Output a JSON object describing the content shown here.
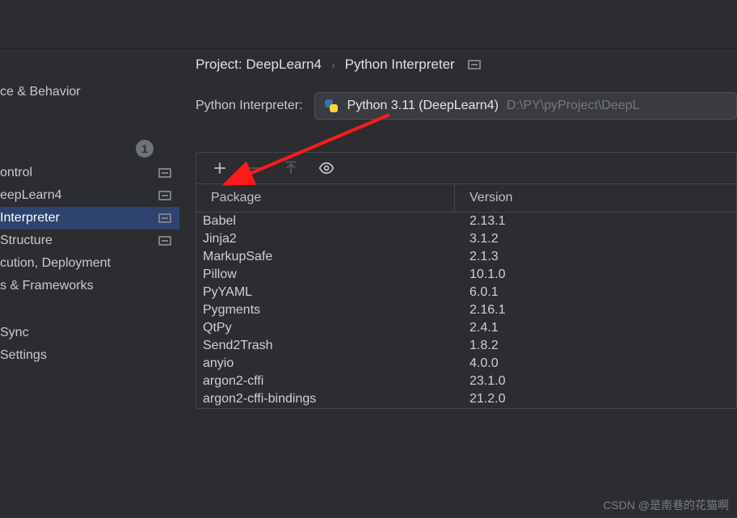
{
  "sidebar": {
    "items": [
      {
        "label": "ce & Behavior",
        "badge": null,
        "modif": false
      },
      {
        "label": "",
        "badge": "1",
        "modif": false
      },
      {
        "label": "ontrol",
        "badge": null,
        "modif": true
      },
      {
        "label": "eepLearn4",
        "badge": null,
        "modif": true
      },
      {
        "label": "Interpreter",
        "badge": null,
        "modif": true
      },
      {
        "label": "Structure",
        "badge": null,
        "modif": true
      },
      {
        "label": "cution, Deployment",
        "badge": null,
        "modif": false
      },
      {
        "label": "s & Frameworks",
        "badge": null,
        "modif": false
      },
      {
        "label": "Sync",
        "badge": null,
        "modif": false
      },
      {
        "label": "Settings",
        "badge": null,
        "modif": false
      }
    ],
    "selected_index": 4
  },
  "breadcrumb": {
    "project_prefix": "Project:",
    "project_name": "DeepLearn4",
    "page": "Python Interpreter"
  },
  "interpreter": {
    "label": "Python Interpreter:",
    "name": "Python 3.11 (DeepLearn4)",
    "path": "D:\\PY\\pyProject\\DeepL"
  },
  "packages": {
    "header_package": "Package",
    "header_version": "Version",
    "rows": [
      {
        "name": "Babel",
        "version": "2.13.1"
      },
      {
        "name": "Jinja2",
        "version": "3.1.2"
      },
      {
        "name": "MarkupSafe",
        "version": "2.1.3"
      },
      {
        "name": "Pillow",
        "version": "10.1.0"
      },
      {
        "name": "PyYAML",
        "version": "6.0.1"
      },
      {
        "name": "Pygments",
        "version": "2.16.1"
      },
      {
        "name": "QtPy",
        "version": "2.4.1"
      },
      {
        "name": "Send2Trash",
        "version": "1.8.2"
      },
      {
        "name": "anyio",
        "version": "4.0.0"
      },
      {
        "name": "argon2-cffi",
        "version": "23.1.0"
      },
      {
        "name": "argon2-cffi-bindings",
        "version": "21.2.0"
      }
    ]
  },
  "watermark": "CSDN @是南巷的花猫啊"
}
